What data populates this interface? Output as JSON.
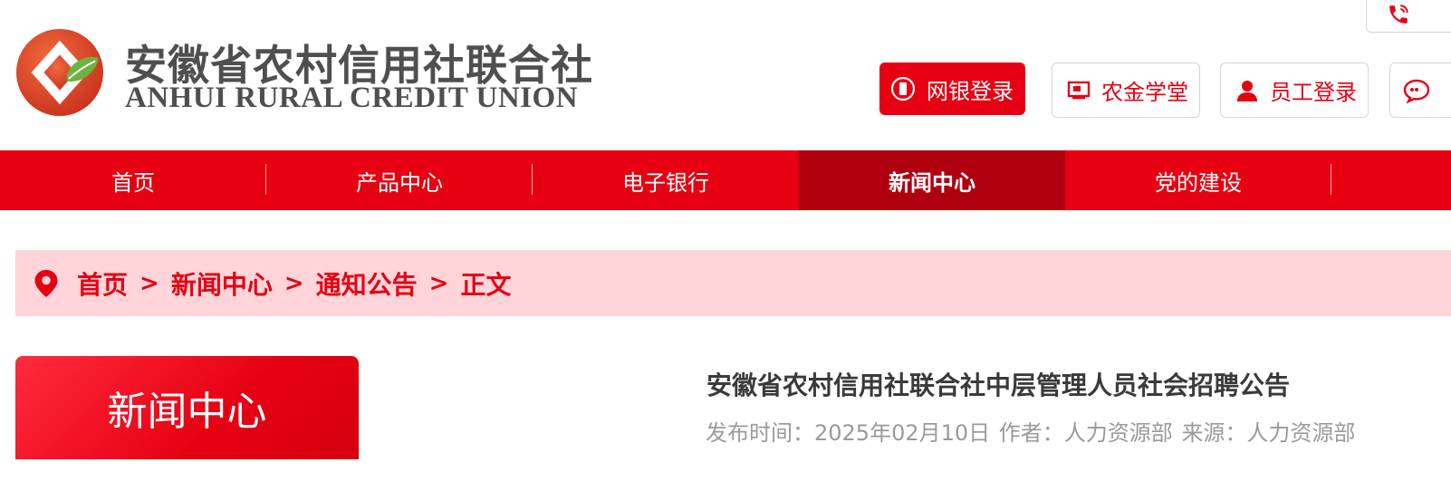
{
  "header": {
    "logo_cn": "安徽省农村信用社联合社",
    "logo_en": "ANHUI RURAL CREDIT UNION",
    "logo_icon": "leaf-diamond-logo",
    "phone_icon": "phone-icon",
    "buttons": [
      {
        "label": "网银登录",
        "icon": "card-icon"
      },
      {
        "label": "农金学堂",
        "icon": "monitor-icon"
      },
      {
        "label": "员工登录",
        "icon": "person-icon"
      },
      {
        "label": "",
        "icon": "chat-icon"
      }
    ]
  },
  "nav": {
    "items": [
      {
        "label": "首页"
      },
      {
        "label": "产品中心"
      },
      {
        "label": "电子银行"
      },
      {
        "label": "新闻中心",
        "active": true
      },
      {
        "label": "党的建设"
      },
      {
        "label": ""
      }
    ]
  },
  "breadcrumb": {
    "icon": "location-pin-icon",
    "items": [
      "首页",
      "新闻中心",
      "通知公告",
      "正文"
    ],
    "separator": ">"
  },
  "sidebar": {
    "title": "新闻中心"
  },
  "article": {
    "title": "安徽省农村信用社联合社中层管理人员社会招聘公告",
    "meta_time": "发布时间：2025年02月10日",
    "meta_author": "作者：人力资源部",
    "meta_source": "来源：人力资源部"
  },
  "colors": {
    "brand_red": "#e60012",
    "nav_active": "#b0000f",
    "breadcrumb_bg": "#ffd5d9",
    "logo_green": "#6cb33f"
  }
}
